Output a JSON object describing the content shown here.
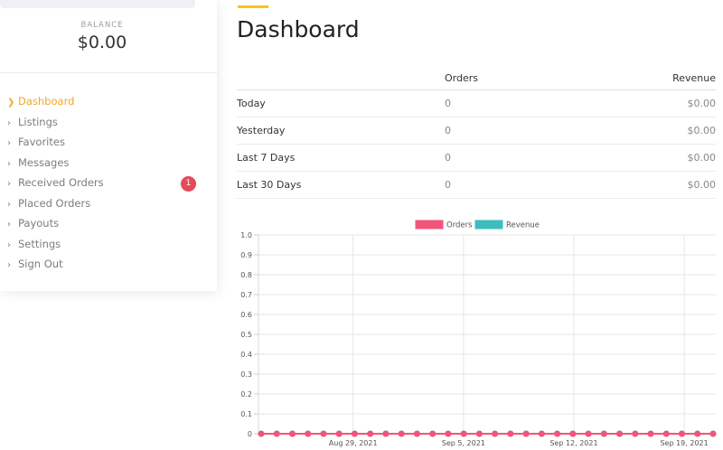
{
  "sidebar": {
    "balance_label": "BALANCE",
    "balance_value": "$0.00",
    "items": [
      {
        "label": "Dashboard",
        "active": true
      },
      {
        "label": "Listings"
      },
      {
        "label": "Favorites"
      },
      {
        "label": "Messages"
      },
      {
        "label": "Received Orders",
        "badge": "1"
      },
      {
        "label": "Placed Orders"
      },
      {
        "label": "Payouts"
      },
      {
        "label": "Settings"
      },
      {
        "label": "Sign Out"
      }
    ],
    "icons": {
      "chevron": "chevron-right-icon"
    }
  },
  "main": {
    "title": "Dashboard",
    "table": {
      "headers": [
        "",
        "Orders",
        "Revenue"
      ],
      "rows": [
        {
          "label": "Today",
          "orders": "0",
          "revenue": "$0.00"
        },
        {
          "label": "Yesterday",
          "orders": "0",
          "revenue": "$0.00"
        },
        {
          "label": "Last 7 Days",
          "orders": "0",
          "revenue": "$0.00"
        },
        {
          "label": "Last 30 Days",
          "orders": "0",
          "revenue": "$0.00"
        }
      ]
    }
  },
  "colors": {
    "accent": "#f5a623",
    "accent_bar": "#f5c518",
    "badge": "#e64a5a",
    "orders": "#f2557a",
    "revenue": "#3dbdbd"
  },
  "chart_data": {
    "type": "line",
    "legend": [
      "Orders",
      "Revenue"
    ],
    "legend_position": "top",
    "ylim": [
      0,
      1
    ],
    "yticks": [
      "1.0",
      "0.9",
      "0.8",
      "0.7",
      "0.6",
      "0.5",
      "0.4",
      "0.3",
      "0.2",
      "0.1",
      "0"
    ],
    "xticks": [
      "Aug 29, 2021",
      "Sep 5, 2021",
      "Sep 12, 2021",
      "Sep 19, 2021"
    ],
    "x_start": "Aug 23, 2021",
    "x_end": "Sep 21, 2021",
    "series": [
      {
        "name": "Orders",
        "values": [
          0,
          0,
          0,
          0,
          0,
          0,
          0,
          0,
          0,
          0,
          0,
          0,
          0,
          0,
          0,
          0,
          0,
          0,
          0,
          0,
          0,
          0,
          0,
          0,
          0,
          0,
          0,
          0,
          0,
          0
        ]
      },
      {
        "name": "Revenue",
        "values": [
          0,
          0,
          0,
          0,
          0,
          0,
          0,
          0,
          0,
          0,
          0,
          0,
          0,
          0,
          0,
          0,
          0,
          0,
          0,
          0,
          0,
          0,
          0,
          0,
          0,
          0,
          0,
          0,
          0,
          0
        ]
      }
    ],
    "grid": true
  }
}
